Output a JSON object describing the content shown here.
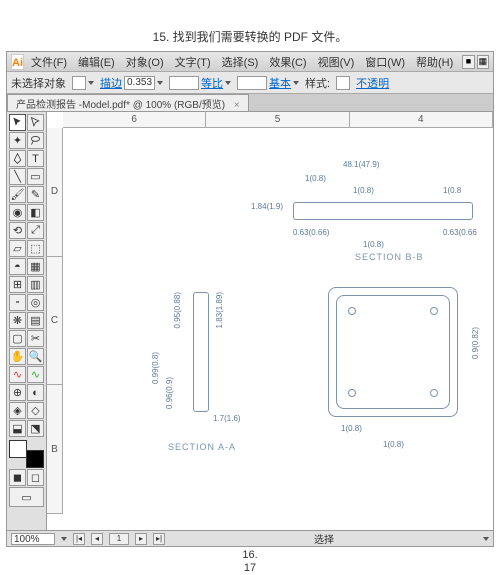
{
  "caption": "15. 找到我们需要转换的 PDF 文件。",
  "footer_a": "16.",
  "footer_b": "17",
  "app": {
    "logo": "Ai",
    "menus": [
      "文件(F)",
      "编辑(E)",
      "对象(O)",
      "文字(T)",
      "选择(S)",
      "效果(C)",
      "视图(V)",
      "窗口(W)",
      "帮助(H)"
    ],
    "hdr_btns": [
      "■",
      "▦"
    ]
  },
  "options": {
    "selection": "未选择对象",
    "stroke_label": "描边",
    "stroke_val": "0.353",
    "uniform": "等比",
    "basic": "基本",
    "style_label": "样式:",
    "opacity": "不透明"
  },
  "tab": {
    "title": "产品检测报告 -Model.pdf* @ 100% (RGB/预览)"
  },
  "ruler_h": [
    "6",
    "5",
    "4"
  ],
  "ruler_v": [
    "D",
    "C",
    "B"
  ],
  "dims": {
    "d1": "48.1(47.9)",
    "d2": "1(0.8)",
    "d3": "1(0.8)",
    "d4": "1(0.8",
    "d5": "1.84(1.9)",
    "d6": "0.63(0.66)",
    "d7": "0.63(0.66",
    "d8": "1(0.8)",
    "v1": "0.95(0.88)",
    "v2": "1.83(1.89)",
    "v3": "0.99(0.8)",
    "v4": "0.96(0.9)",
    "v5": "0.9(0.82)",
    "d9": "1.7(1.6)",
    "d10": "1(0.8)",
    "d11": "1(0.8)",
    "sect_bb": "SECTION B-B",
    "sect_aa": "SECTION A-A"
  },
  "status": {
    "zoom": "100%",
    "label": "选择"
  }
}
